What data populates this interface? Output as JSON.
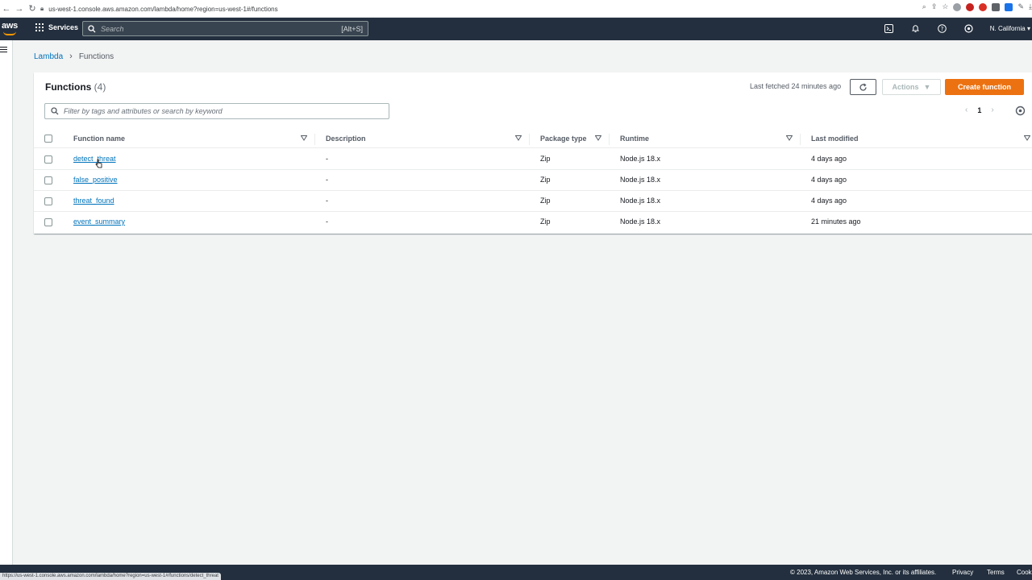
{
  "browser": {
    "url": "us-west-1.console.aws.amazon.com/lambda/home?region=us-west-1#/functions",
    "status_url": "https://us-west-1.console.aws.amazon.com/lambda/home?region=us-west-1#/functions/detect_threat"
  },
  "nav": {
    "logo": "aws",
    "services_label": "Services",
    "search_placeholder": "Search",
    "search_shortcut": "[Alt+S]",
    "region": "N. California"
  },
  "breadcrumb": {
    "parent": "Lambda",
    "current": "Functions"
  },
  "panel": {
    "title": "Functions",
    "count": "(4)",
    "last_fetched": "Last fetched 24 minutes ago",
    "actions_label": "Actions",
    "create_label": "Create function",
    "filter_placeholder": "Filter by tags and attributes or search by keyword",
    "page": "1"
  },
  "table": {
    "columns": {
      "name": "Function name",
      "description": "Description",
      "package_type": "Package type",
      "runtime": "Runtime",
      "last_modified": "Last modified"
    },
    "rows": [
      {
        "name": "detect_threat",
        "description": "-",
        "package_type": "Zip",
        "runtime": "Node.js 18.x",
        "last_modified": "4 days ago"
      },
      {
        "name": "false_positive",
        "description": "-",
        "package_type": "Zip",
        "runtime": "Node.js 18.x",
        "last_modified": "4 days ago"
      },
      {
        "name": "threat_found",
        "description": "-",
        "package_type": "Zip",
        "runtime": "Node.js 18.x",
        "last_modified": "4 days ago"
      },
      {
        "name": "event_summary",
        "description": "-",
        "package_type": "Zip",
        "runtime": "Node.js 18.x",
        "last_modified": "21 minutes ago"
      }
    ]
  },
  "footer": {
    "copyright": "© 2023, Amazon Web Services, Inc. or its affiliates.",
    "privacy": "Privacy",
    "terms": "Terms",
    "cookie": "Cook"
  },
  "colors": {
    "nav_bg": "#232f3e",
    "accent_orange": "#ec7211",
    "link_blue": "#0073bb"
  }
}
